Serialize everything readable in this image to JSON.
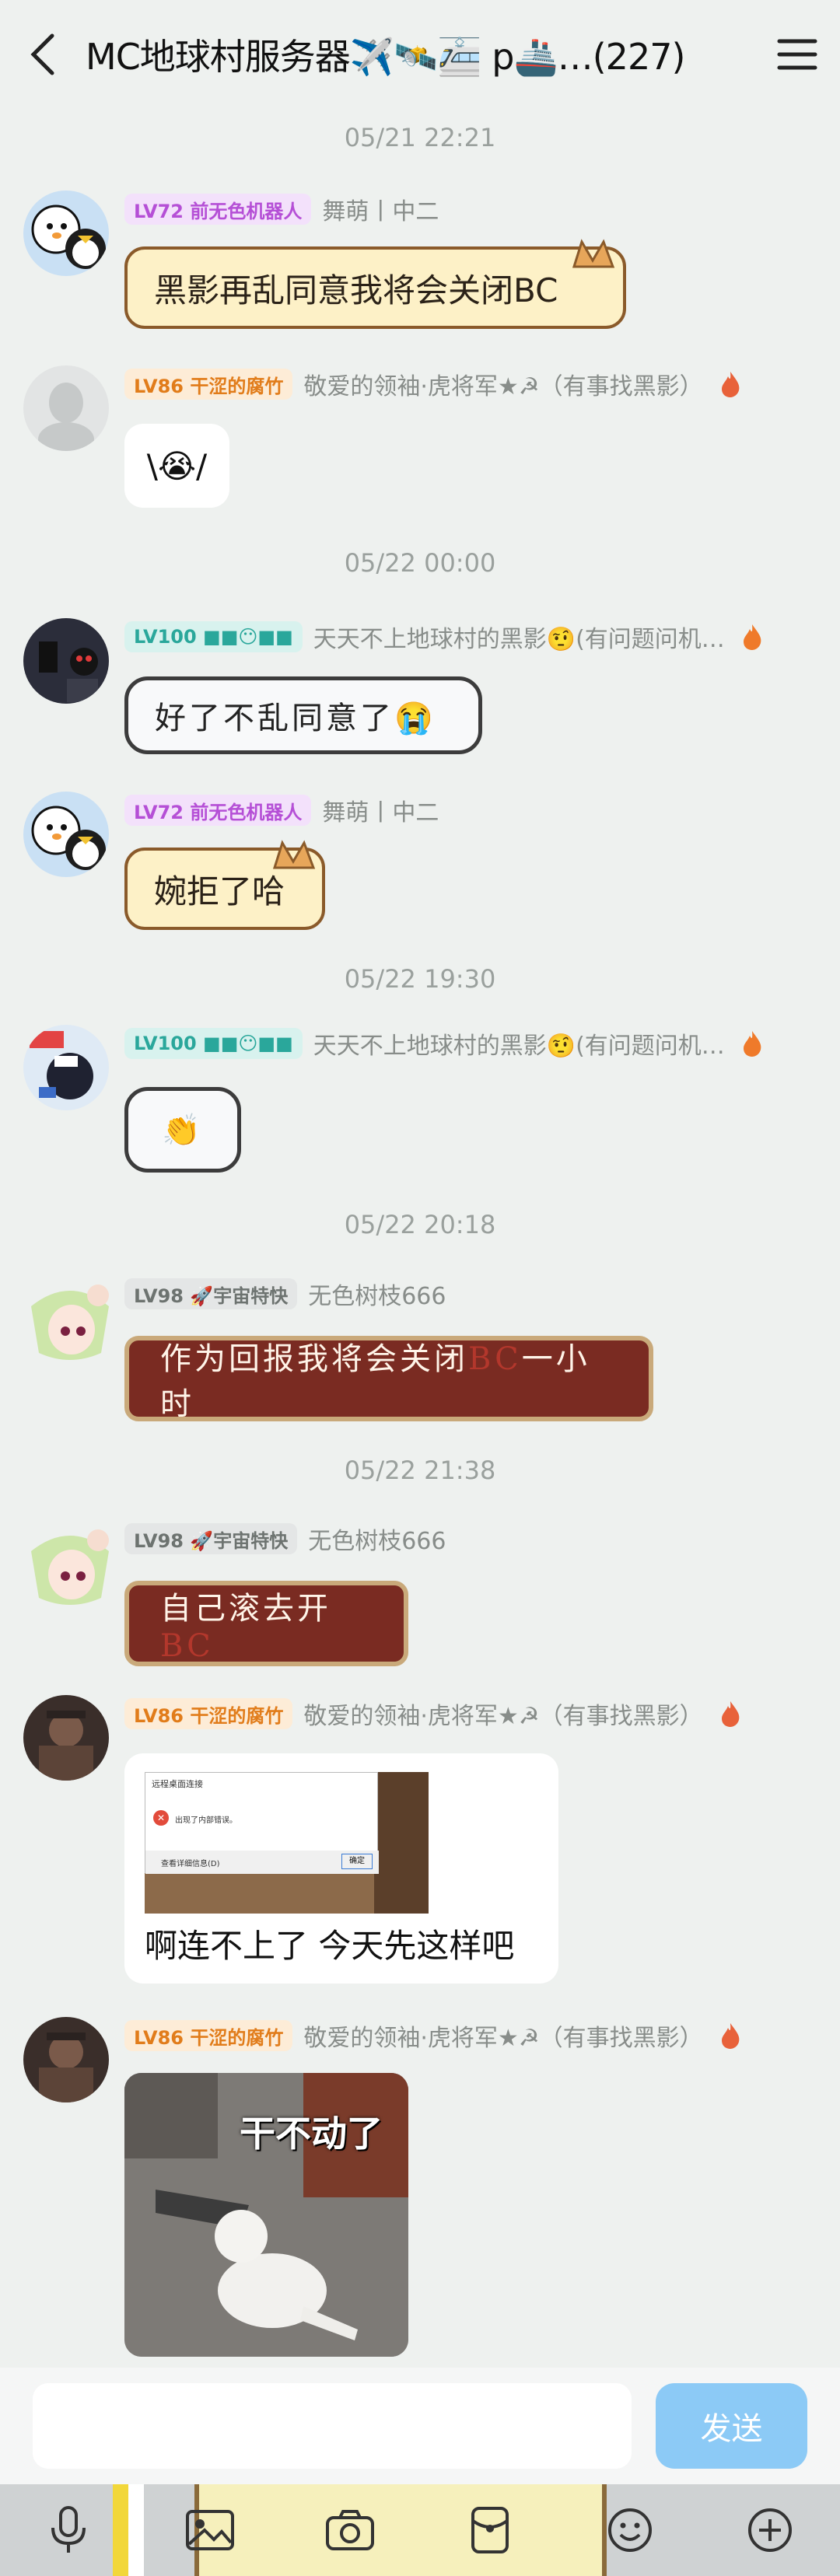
{
  "header": {
    "title": "MC地球村服务器✈️🛰️🚈 p🚢…(227)",
    "back_label": "<",
    "menu_label": "≡"
  },
  "messages": [
    {
      "type": "time",
      "text": "05/21 22:21"
    },
    {
      "type": "msg",
      "level": "LV72 前无色机器人",
      "nick": "舞萌丨中二",
      "text": "黑影再乱同意我将会关闭BC"
    },
    {
      "type": "msg",
      "level": "LV86 干涩的腐竹",
      "nick": "敬爱的领袖·虎将军★☭（有事找黑影）",
      "text": "\\😭/"
    },
    {
      "type": "time",
      "text": "05/22 00:00"
    },
    {
      "type": "msg",
      "level": "LV100 ■■😶■■",
      "nick": "天天不上地球村的黑影🤨(有问题问机…",
      "text": "好了不乱同意了😭"
    },
    {
      "type": "msg",
      "level": "LV72 前无色机器人",
      "nick": "舞萌丨中二",
      "text": "婉拒了哈"
    },
    {
      "type": "time",
      "text": "05/22 19:30"
    },
    {
      "type": "msg",
      "level": "LV100 ■■😶■■",
      "nick": "天天不上地球村的黑影🤨(有问题问机…",
      "text": "👏"
    },
    {
      "type": "time",
      "text": "05/22 20:18"
    },
    {
      "type": "msg",
      "level": "LV98 🚀宇宙特快",
      "nick": "无色树枝666",
      "text_before": "作为回报我将会关闭",
      "text_red": "BC",
      "text_after": "一小时"
    },
    {
      "type": "time",
      "text": "05/22 21:38"
    },
    {
      "type": "msg",
      "level": "LV98 🚀宇宙特快",
      "nick": "无色树枝666",
      "text_before": "自己滚去开",
      "text_red": "BC"
    },
    {
      "type": "msg",
      "level": "LV86 干涩的腐竹",
      "nick": "敬爱的领袖·虎将军★☭（有事找黑影）",
      "text": "啊连不上了 今天先这样吧",
      "dialog_title": "远程桌面连接",
      "dialog_msg": "出现了内部错误。",
      "dialog_details": "查看详细信息(D)",
      "dialog_ok": "确定"
    },
    {
      "type": "msg",
      "level": "LV86 干涩的腐竹",
      "nick": "敬爱的领袖·虎将军★☭（有事找黑影）",
      "meme_caption": "干不动了"
    }
  ],
  "input": {
    "send_label": "发送",
    "placeholder": ""
  },
  "colors": {
    "background": "#eef1ef",
    "send": "#8ccaf6",
    "toolbar": "#cfd2d3"
  }
}
